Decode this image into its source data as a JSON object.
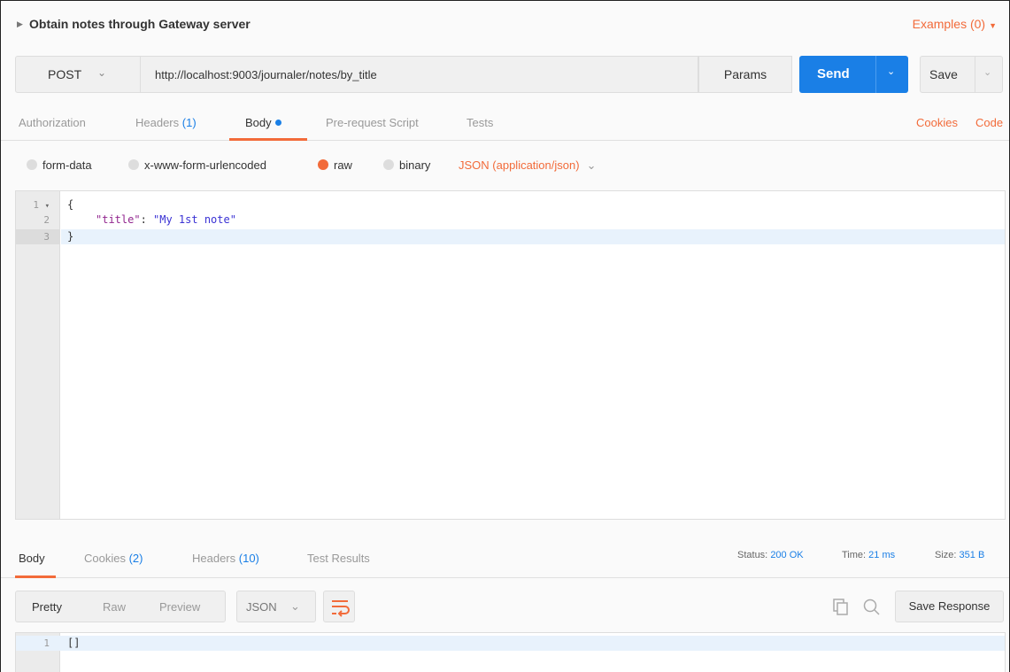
{
  "request": {
    "title": "Obtain notes through Gateway server",
    "examples_label": "Examples (0)",
    "method": "POST",
    "url": "http://localhost:9003/journaler/notes/by_title",
    "params_label": "Params",
    "send_label": "Send",
    "save_label": "Save"
  },
  "request_tabs": {
    "authorization": "Authorization",
    "headers": "Headers",
    "headers_count": "(1)",
    "body": "Body",
    "prerequest": "Pre-request Script",
    "tests": "Tests",
    "cookies": "Cookies",
    "code": "Code"
  },
  "body_modes": {
    "form_data": "form-data",
    "urlencoded": "x-www-form-urlencoded",
    "raw": "raw",
    "binary": "binary",
    "selected": "raw",
    "content_type": "JSON (application/json)"
  },
  "editor": {
    "lines": [
      {
        "num": "1",
        "text": "{"
      },
      {
        "num": "2",
        "key": "\"title\"",
        "sep": ": ",
        "value": "\"My 1st note\""
      },
      {
        "num": "3",
        "text": "}"
      }
    ]
  },
  "response_tabs": {
    "body": "Body",
    "cookies": "Cookies",
    "cookies_count": "(2)",
    "headers": "Headers",
    "headers_count": "(10)",
    "test_results": "Test Results"
  },
  "response_status": {
    "status_label": "Status:",
    "status_value": "200 OK",
    "time_label": "Time:",
    "time_value": "21 ms",
    "size_label": "Size:",
    "size_value": "351 B"
  },
  "response_toolbar": {
    "pretty": "Pretty",
    "raw": "Raw",
    "preview": "Preview",
    "format": "JSON",
    "save_response": "Save Response"
  },
  "response_body": {
    "lines": [
      {
        "num": "1",
        "text": "[]"
      }
    ]
  },
  "colors": {
    "accent": "#f26b3a",
    "primary": "#1a7fe6"
  },
  "icons": [
    "caret-right-icon",
    "caret-down-icon",
    "chevron-down-icon",
    "wrap-lines-icon",
    "copy-icon",
    "search-icon"
  ]
}
